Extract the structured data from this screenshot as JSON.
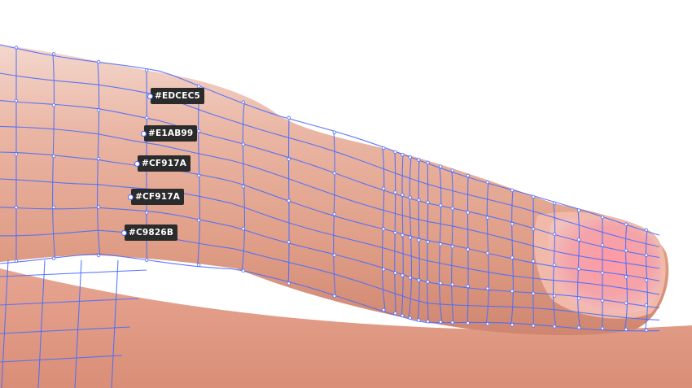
{
  "swatches": [
    {
      "label": "#EDCEC5",
      "color": "#EDCEC5"
    },
    {
      "label": "#E1AB99",
      "color": "#E1AB99"
    },
    {
      "label": "#CF917A",
      "color": "#CF917A"
    },
    {
      "label": "#CF917A",
      "color": "#CF917A"
    },
    {
      "label": "#C9826B",
      "color": "#C9826B"
    }
  ],
  "colors": {
    "mesh_line": "#4a6cff",
    "skin_base": "#E1AB99",
    "nail": "#f4a3a6",
    "background_skin": "#e3a591"
  }
}
